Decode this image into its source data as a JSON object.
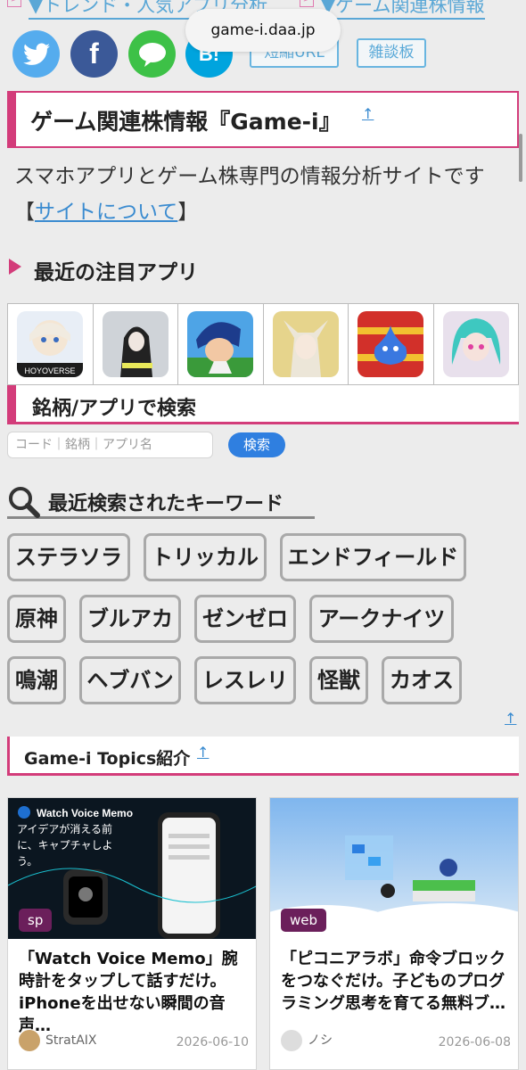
{
  "topnav": {
    "left_link": "▼トレンド・人気アプリ分析",
    "right_link": "▼ゲーム関連株情報",
    "box_mark": ">"
  },
  "browser": {
    "url": "game-i.daa.jp"
  },
  "share": {
    "twitter_glyph": "t",
    "facebook_glyph": "f",
    "line_glyph": "…",
    "hatena_glyph": "B!",
    "short_url_label": "短縮URL",
    "forum_label": "雑談板"
  },
  "site": {
    "title": "ゲーム関連株情報『Game-i』",
    "up_mark": "↑",
    "description": "スマホアプリとゲーム株専門の情報分析サイトです",
    "about_open": "【",
    "about_link": "サイトについて",
    "about_close": "】"
  },
  "featured": {
    "heading": "最近の注目アプリ",
    "apps": [
      {
        "name": "hoyoverse-app-icon",
        "caption": "HOYOVERSE"
      },
      {
        "name": "cyberpunk-app-icon",
        "caption": ""
      },
      {
        "name": "soccer-app-icon",
        "caption": ""
      },
      {
        "name": "foxgirl-app-icon",
        "caption": ""
      },
      {
        "name": "dragonquest-slime-app-icon",
        "caption": ""
      },
      {
        "name": "anime-girl-app-icon",
        "caption": ""
      }
    ]
  },
  "search": {
    "heading": "銘柄/アプリで検索",
    "placeholder": "コード｜銘柄｜アプリ名",
    "button": "検索"
  },
  "keywords": {
    "heading": "最近検索されたキーワード",
    "items": [
      "ステラソラ",
      "トリッカル",
      "エンドフィールド",
      "原神",
      "ブルアカ",
      "ゼンゼロ",
      "アークナイツ",
      "鳴潮",
      "ヘブバン",
      "レスレリ",
      "怪獣",
      "カオス"
    ]
  },
  "topics": {
    "heading": "Game-i Topics紹介",
    "up_mark": "↑",
    "cards": [
      {
        "badge": "sp",
        "image_heading": "Watch Voice Memo",
        "image_tagline": "アイデアが消える前に、キャプチャしよう。",
        "title": "「Watch Voice Memo」腕時計をタップして話すだけ。iPhoneを出せない瞬間の音声…",
        "author": "StratAIX",
        "date": "2026-06-10"
      },
      {
        "badge": "web",
        "title": "「ピコニアラボ」命令ブロックをつなぐだけ。子どものプログラミング思考を育てる無料ブ…",
        "author": "ノシ",
        "date": "2026-06-08"
      }
    ]
  }
}
